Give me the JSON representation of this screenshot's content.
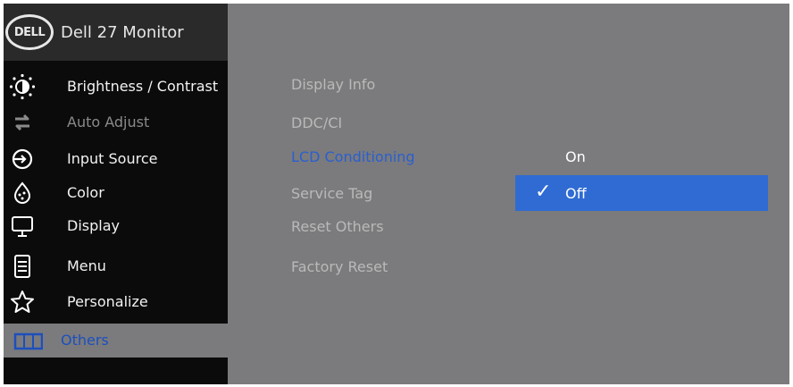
{
  "header": {
    "logo_text": "DELL",
    "title": "Dell 27 Monitor"
  },
  "sidebar": {
    "items": [
      {
        "label": "Brightness / Contrast",
        "icon": "brightness-icon"
      },
      {
        "label": "Auto Adjust",
        "icon": "auto-adjust-icon"
      },
      {
        "label": "Input Source",
        "icon": "input-source-icon"
      },
      {
        "label": "Color",
        "icon": "color-palette-icon"
      },
      {
        "label": "Display",
        "icon": "display-icon"
      },
      {
        "label": "Menu",
        "icon": "menu-icon"
      },
      {
        "label": "Personalize",
        "icon": "star-icon"
      },
      {
        "label": "Others",
        "icon": "others-icon"
      }
    ],
    "selected": "Others"
  },
  "submenu": {
    "items": [
      {
        "label": "Display Info"
      },
      {
        "label": "DDC/CI"
      },
      {
        "label": "LCD Conditioning"
      },
      {
        "label": "Service Tag"
      },
      {
        "label": "Reset Others"
      },
      {
        "label": "Factory Reset"
      }
    ],
    "active": "LCD Conditioning"
  },
  "options": {
    "items": [
      {
        "label": "On"
      },
      {
        "label": "Off"
      }
    ],
    "selected": "Off",
    "check_glyph": "✓"
  },
  "colors": {
    "osd_background": "#7b7b7d",
    "sidebar_background": "#0b0b0b",
    "highlight": "#2f6bd3",
    "active_text": "#2a5fd0"
  }
}
